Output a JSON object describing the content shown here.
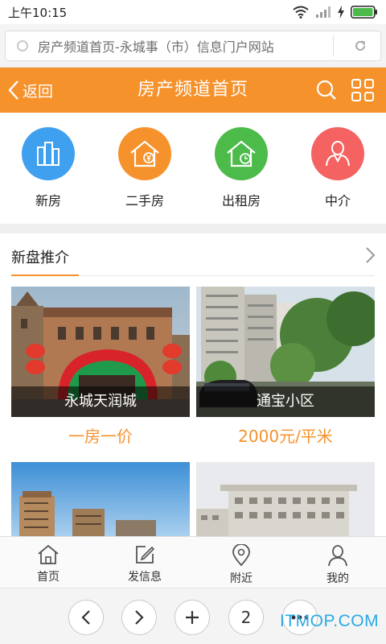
{
  "status_bar": {
    "time": "上午10:15"
  },
  "url_bar": {
    "text": "房产频道首页-永城事（市）信息门户网站"
  },
  "header": {
    "back_label": "返回",
    "title": "房产频道首页",
    "color": "#f6922c"
  },
  "categories": [
    {
      "label": "新房",
      "icon": "buildings-icon",
      "color": "#3fa0f0"
    },
    {
      "label": "二手房",
      "icon": "house-yen-icon",
      "color": "#f6922c"
    },
    {
      "label": "出租房",
      "icon": "house-clock-icon",
      "color": "#4cbb4a"
    },
    {
      "label": "中介",
      "icon": "person-icon",
      "color": "#f46262"
    }
  ],
  "section": {
    "title": "新盘推介"
  },
  "listings": [
    {
      "name": "永城天润城",
      "price": "一房一价"
    },
    {
      "name": "通宝小区",
      "price": "2000元/平米"
    }
  ],
  "tabbar": [
    {
      "label": "首页",
      "icon": "home-icon"
    },
    {
      "label": "发信息",
      "icon": "edit-icon"
    },
    {
      "label": "附近",
      "icon": "location-pin-icon"
    },
    {
      "label": "我的",
      "icon": "user-icon"
    }
  ],
  "browser_nav": {
    "tab_count": "2"
  },
  "watermark": "ITMOP.COM"
}
